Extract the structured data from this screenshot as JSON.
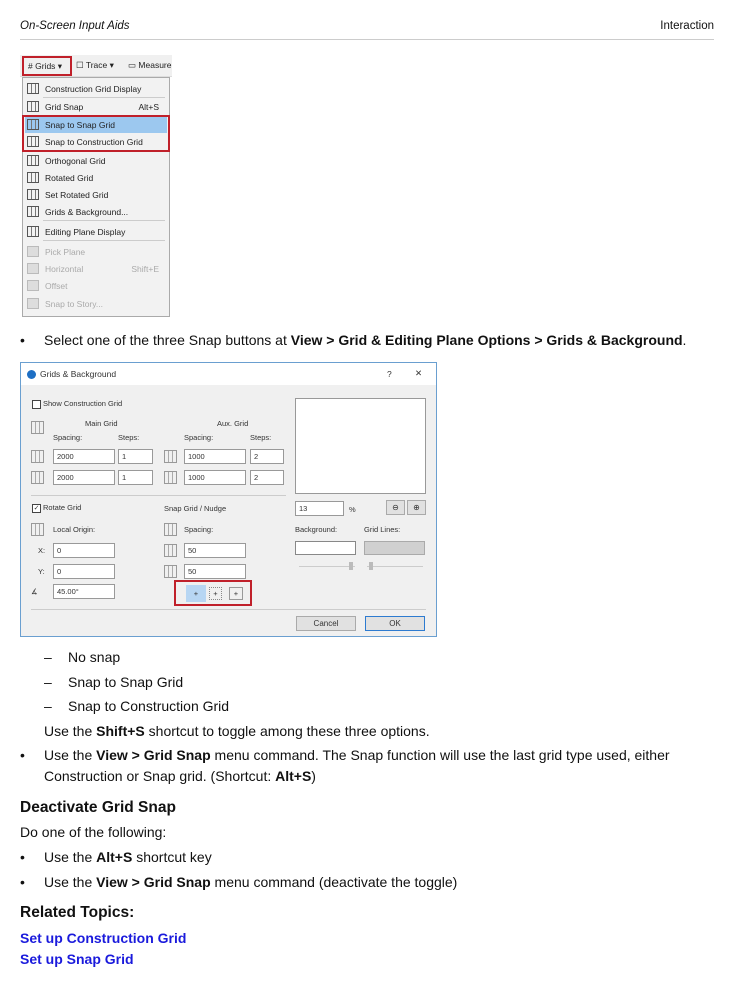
{
  "header": {
    "left": "On-Screen Input Aids",
    "right": "Interaction"
  },
  "menu": {
    "toolbar": {
      "grids": "Grids",
      "trace": "Trace",
      "measure": "Measure"
    },
    "items": [
      {
        "label": "Construction Grid Display",
        "shortcut": "",
        "state": "normal",
        "icon": "construction-grid-icon"
      },
      {
        "label": "Grid Snap",
        "shortcut": "Alt+S",
        "state": "normal",
        "icon": "grid-snap-icon"
      },
      {
        "label": "Snap to Snap Grid",
        "shortcut": "",
        "state": "selected",
        "icon": "snap-grid-icon"
      },
      {
        "label": "Snap to Construction Grid",
        "shortcut": "",
        "state": "normal",
        "icon": "construction-snap-icon"
      },
      {
        "label": "Orthogonal Grid",
        "shortcut": "",
        "state": "normal",
        "icon": "orthogonal-grid-icon"
      },
      {
        "label": "Rotated Grid",
        "shortcut": "",
        "state": "normal",
        "icon": "rotated-grid-icon"
      },
      {
        "label": "Set Rotated Grid",
        "shortcut": "",
        "state": "normal",
        "icon": "set-rotated-grid-icon"
      },
      {
        "label": "Grids & Background...",
        "shortcut": "",
        "state": "normal",
        "icon": "grids-background-icon"
      },
      {
        "label": "Editing Plane Display",
        "shortcut": "",
        "state": "normal",
        "icon": "editing-plane-icon"
      },
      {
        "label": "Pick Plane",
        "shortcut": "",
        "state": "disabled",
        "icon": "pick-plane-icon"
      },
      {
        "label": "Horizontal",
        "shortcut": "Shift+E",
        "state": "disabled",
        "icon": "horizontal-icon"
      },
      {
        "label": "Offset",
        "shortcut": "",
        "state": "disabled",
        "icon": "offset-icon"
      },
      {
        "label": "Snap to Story...",
        "shortcut": "",
        "state": "disabled",
        "icon": "snap-story-icon"
      }
    ]
  },
  "bullet1": {
    "pre": "Select one of the three Snap buttons at ",
    "bold": "View > Grid & Editing Plane Options > Grids & Background",
    "post": "."
  },
  "dialog": {
    "title": "Grids & Background",
    "help": "?",
    "close": "✕",
    "show_construction_grid": "Show Construction Grid",
    "main_grid": "Main Grid",
    "aux_grid": "Aux. Grid",
    "spacing": "Spacing:",
    "steps": "Steps:",
    "main_spacing_x": "2000",
    "main_steps_x": "1",
    "main_spacing_y": "2000",
    "main_steps_y": "1",
    "aux_spacing_x": "1000",
    "aux_steps_x": "2",
    "aux_spacing_y": "1000",
    "aux_steps_y": "2",
    "rotate_grid": "Rotate Grid",
    "local_origin": "Local Origin:",
    "x_label": "X:",
    "y_label": "Y:",
    "x_value": "0",
    "y_value": "0",
    "angle": "45.00°",
    "snap_grid_nudge": "Snap Grid / Nudge",
    "snap_spacing": "Spacing:",
    "snap_x": "50",
    "snap_y": "50",
    "zoom_value": "13",
    "percent": "%",
    "background": "Background:",
    "grid_lines": "Grid Lines:",
    "cancel": "Cancel",
    "ok": "OK"
  },
  "options": [
    "No snap",
    "Snap to Snap Grid",
    "Snap to Construction Grid"
  ],
  "shift_line": {
    "pre": "Use the ",
    "bold": "Shift+S",
    "post": " shortcut to toggle among these three options."
  },
  "bullet2": {
    "pre": "Use the ",
    "bold": "View > Grid Snap",
    "post": " menu command. The Snap function will use the last grid type used, either",
    "line2_pre": "Construction or Snap grid. (Shortcut: ",
    "line2_bold": "Alt+S",
    "line2_post": ")"
  },
  "deactivate": {
    "title": "Deactivate Grid Snap",
    "intro": "Do one of the following:",
    "b1": {
      "pre": "Use the ",
      "bold": "Alt+S",
      "post": " shortcut key"
    },
    "b2": {
      "pre": "Use the ",
      "bold": "View > Grid Snap",
      "post": " menu command (deactivate the toggle)"
    }
  },
  "related": {
    "title": "Related Topics:",
    "links": [
      "Set up Construction Grid",
      "Set up Snap Grid"
    ]
  },
  "bullet_char": "•",
  "dash_char": "–"
}
